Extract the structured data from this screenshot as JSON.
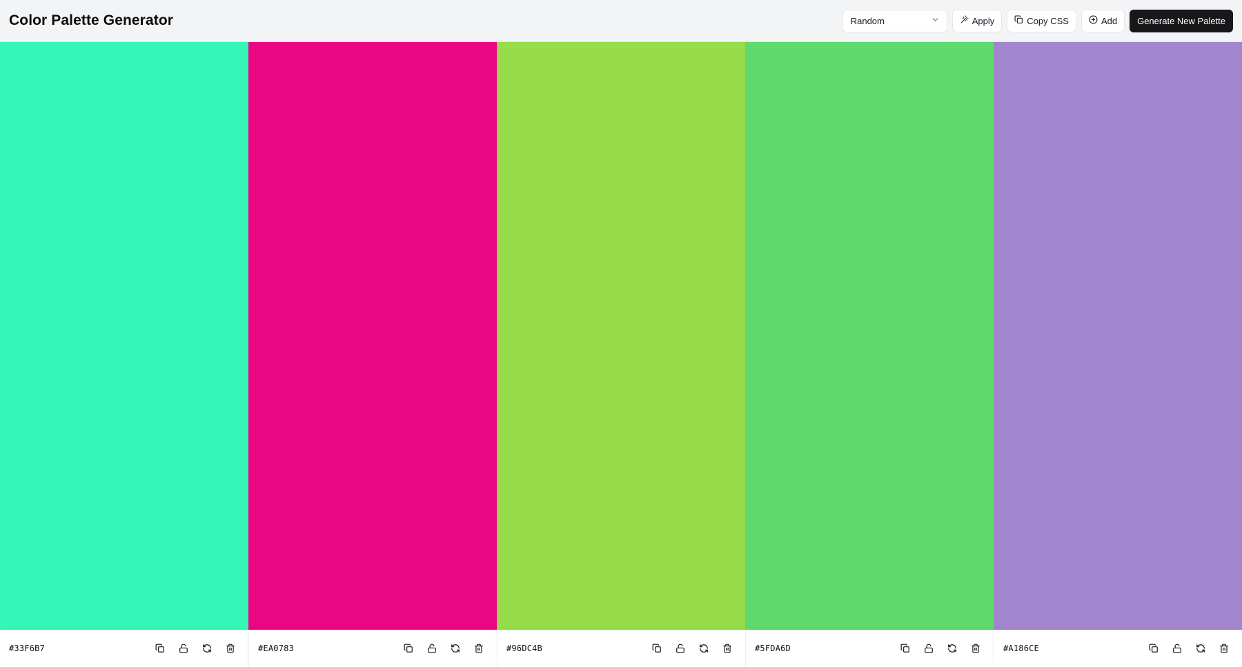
{
  "header": {
    "title": "Color Palette Generator"
  },
  "toolbar": {
    "mode_select": {
      "selected": "Random",
      "icon": "chevron-down-icon"
    },
    "apply_label": "Apply",
    "apply_icon": "wand-icon",
    "copy_css_label": "Copy CSS",
    "copy_css_icon": "copy-icon",
    "add_label": "Add",
    "add_icon": "plus-circle-icon",
    "generate_label": "Generate New Palette"
  },
  "palette": {
    "colors": [
      {
        "hex": "#33F6B7"
      },
      {
        "hex": "#EA0783"
      },
      {
        "hex": "#96DC4B"
      },
      {
        "hex": "#5FDA6D"
      },
      {
        "hex": "#A186CE"
      }
    ],
    "swatch_actions": [
      "copy-icon",
      "lock-open-icon",
      "refresh-icon",
      "trash-icon"
    ]
  },
  "colors": {
    "header_bg": "#f3f4f6",
    "primary_button_bg": "#18181b",
    "primary_button_text": "#ffffff"
  }
}
